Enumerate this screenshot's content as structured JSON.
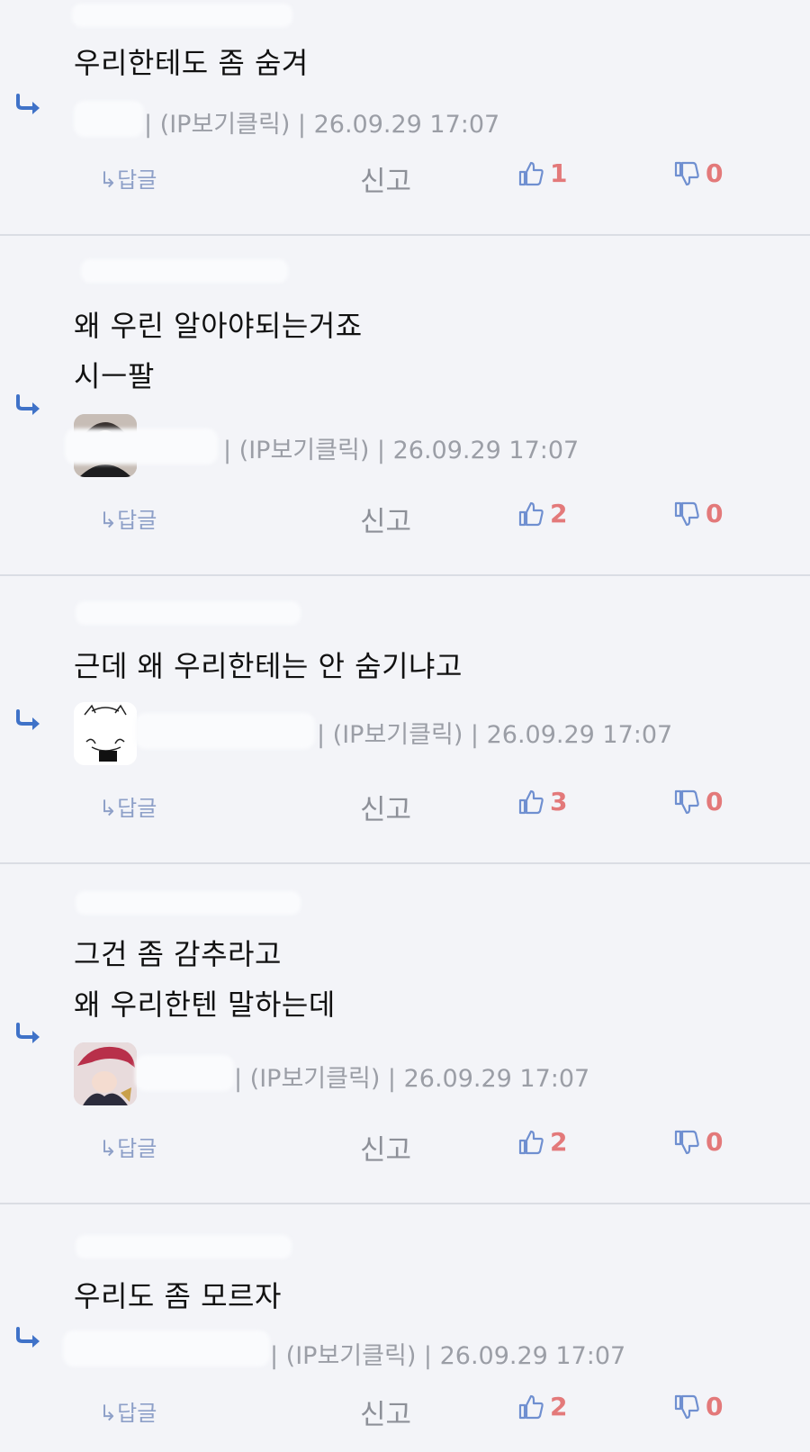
{
  "comments": [
    {
      "lines": [
        "우리한테도 좀 숨겨"
      ],
      "meta": "| (IP보기클릭) | 26.09.29 17:07",
      "reply_label": "↳답글",
      "report_label": "신고",
      "likes": "1",
      "dislikes": "0",
      "avatar": "none"
    },
    {
      "lines": [
        "왜 우린 알아야되는거죠",
        "시ㅡ팔"
      ],
      "meta": "| (IP보기클릭) | 26.09.29 17:07",
      "reply_label": "↳답글",
      "report_label": "신고",
      "likes": "2",
      "dislikes": "0",
      "avatar": "photo"
    },
    {
      "lines": [
        "근데 왜 우리한테는 안 숨기냐고"
      ],
      "meta": "| (IP보기클릭) | 26.09.29 17:07",
      "reply_label": "↳답글",
      "report_label": "신고",
      "likes": "3",
      "dislikes": "0",
      "avatar": "sketch"
    },
    {
      "lines": [
        "그건 좀 감추라고",
        "왜 우리한텐 말하는데"
      ],
      "meta": "| (IP보기클릭) | 26.09.29 17:07",
      "reply_label": "↳답글",
      "report_label": "신고",
      "likes": "2",
      "dislikes": "0",
      "avatar": "anime"
    },
    {
      "lines": [
        "우리도 좀 모르자"
      ],
      "meta": "| (IP보기클릭) | 26.09.29 17:07",
      "reply_label": "↳답글",
      "report_label": "신고",
      "likes": "2",
      "dislikes": "0",
      "avatar": "none"
    }
  ],
  "icons": {
    "reply_arrow": "reply-arrow-icon",
    "like": "thumbs-up-icon",
    "dislike": "thumbs-down-icon"
  },
  "colors": {
    "accent_blue": "#3f72c8",
    "vote_count": "#e3797a",
    "meta_text": "#9b9ea6",
    "background": "#f3f4f8"
  }
}
